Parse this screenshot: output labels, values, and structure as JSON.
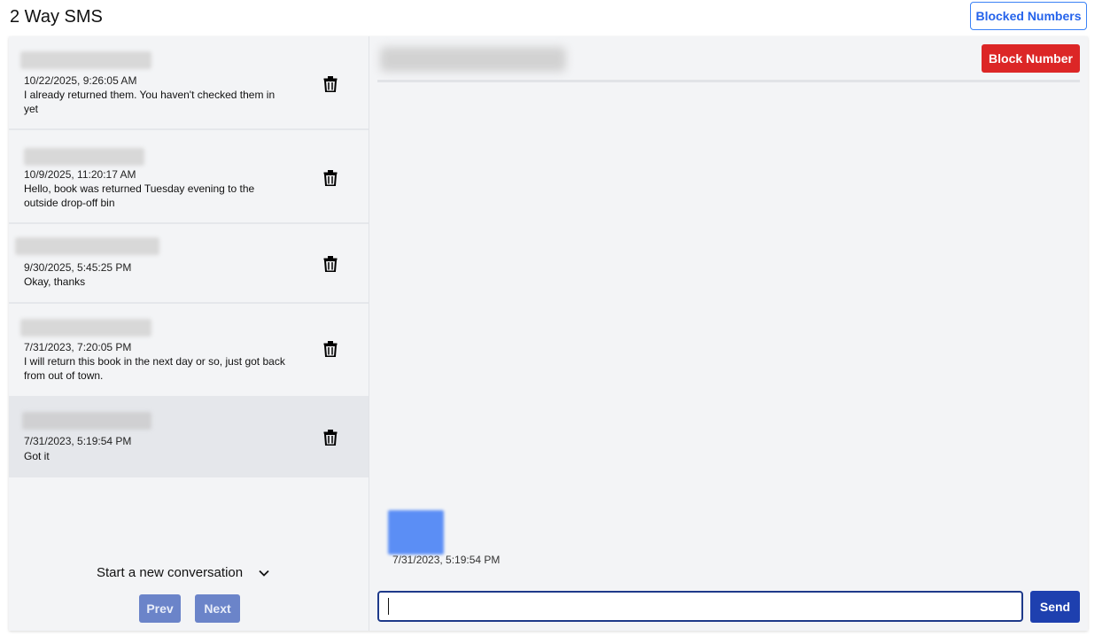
{
  "app": {
    "title": "2 Way SMS",
    "blocked_numbers_label": "Blocked Numbers"
  },
  "conversations": [
    {
      "date": "10/22/2025, 9:26:05 AM",
      "text": "I already returned them. You haven't checked them in yet",
      "selected": false
    },
    {
      "date": "10/9/2025, 11:20:17 AM",
      "text": "Hello, book was returned Tuesday evening to the outside drop-off bin",
      "selected": false
    },
    {
      "date": "9/30/2025, 5:45:25 PM",
      "text": "Okay, thanks",
      "selected": false
    },
    {
      "date": "7/31/2023, 7:20:05 PM",
      "text": "I will return this book in the next day or so, just got back from out of town.",
      "selected": false
    },
    {
      "date": "7/31/2023, 5:19:54 PM",
      "text": "Got it",
      "selected": true
    }
  ],
  "sidebar": {
    "new_conversation_label": "Start a new conversation",
    "prev_label": "Prev",
    "next_label": "Next"
  },
  "chat": {
    "block_number_label": "Block Number",
    "messages": [
      {
        "time": "7/31/2023, 5:19:54 PM"
      }
    ],
    "compose_value": "",
    "send_label": "Send"
  },
  "icons": {
    "delete": "trash-icon",
    "dropdown": "chevron-down-icon"
  },
  "colors": {
    "block_button": "#dc2626",
    "send_button": "#1e40af",
    "pager_button": "#6b84c9",
    "blocked_numbers_border": "#3b82f6"
  }
}
